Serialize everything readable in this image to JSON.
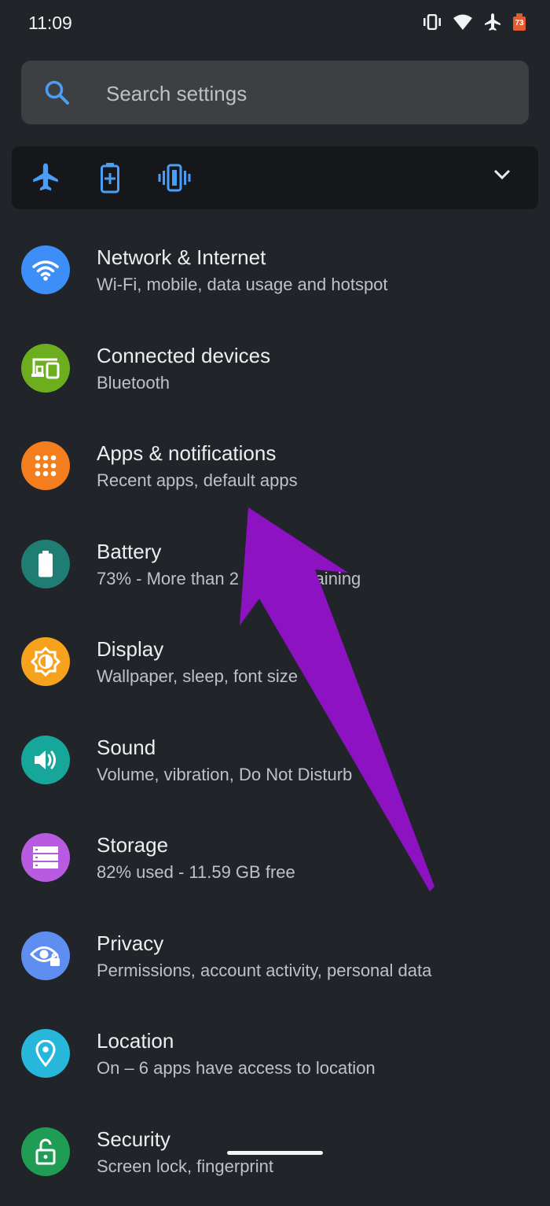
{
  "status_bar": {
    "time": "11:09",
    "battery_level": "73"
  },
  "search": {
    "placeholder": "Search settings"
  },
  "condition_bar": {
    "icons": [
      "airplane-icon",
      "battery-saver-icon",
      "vibrate-icon"
    ],
    "expand_icon": "chevron-down-icon"
  },
  "settings": [
    {
      "title": "Network & Internet",
      "subtitle": "Wi-Fi, mobile, data usage and hotspot",
      "icon": "wifi-icon",
      "color": "#3d8ff7"
    },
    {
      "title": "Connected devices",
      "subtitle": "Bluetooth",
      "icon": "devices-icon",
      "color": "#6cae1e"
    },
    {
      "title": "Apps & notifications",
      "subtitle": "Recent apps, default apps",
      "icon": "apps-grid-icon",
      "color": "#f47d1d"
    },
    {
      "title": "Battery",
      "subtitle": "73% - More than 2 days remaining",
      "icon": "battery-icon",
      "color": "#1f7d74"
    },
    {
      "title": "Display",
      "subtitle": "Wallpaper, sleep, font size",
      "icon": "brightness-icon",
      "color": "#f6a21d"
    },
    {
      "title": "Sound",
      "subtitle": "Volume, vibration, Do Not Disturb",
      "icon": "volume-icon",
      "color": "#16a69a"
    },
    {
      "title": "Storage",
      "subtitle": "82% used - 11.59 GB free",
      "icon": "storage-icon",
      "color": "#b95be0"
    },
    {
      "title": "Privacy",
      "subtitle": "Permissions, account activity, personal data",
      "icon": "privacy-eye-icon",
      "color": "#5d8ef0"
    },
    {
      "title": "Location",
      "subtitle": "On – 6 apps have access to location",
      "icon": "location-pin-icon",
      "color": "#26b7da"
    },
    {
      "title": "Security",
      "subtitle": "Screen lock, fingerprint",
      "icon": "lock-open-icon",
      "color": "#1f9d55"
    }
  ],
  "colors": {
    "background": "#212429",
    "search_bar": "#3c4043",
    "condition_bar": "#15171a",
    "accent": "#4b9ef5",
    "annotation_arrow": "#8d12c2"
  }
}
